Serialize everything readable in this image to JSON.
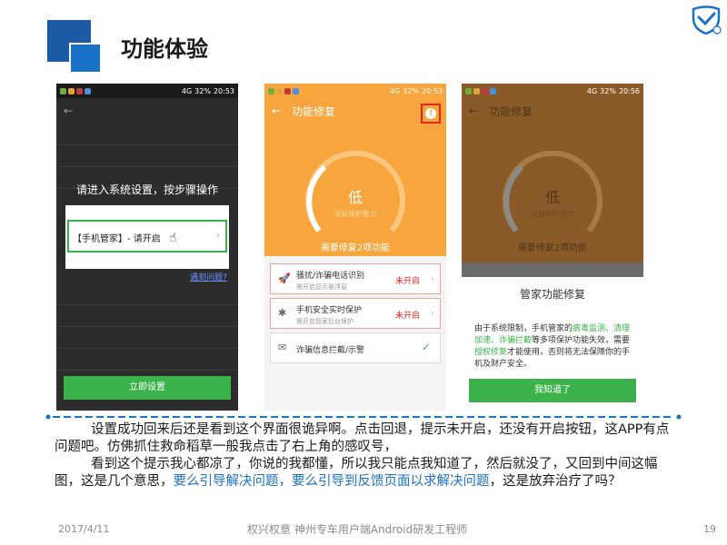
{
  "slide": {
    "title": "功能体验",
    "logo_icon": "shield-check-icon"
  },
  "phone1": {
    "status_time": "20:53",
    "status_battery": "32%",
    "status_signal": "4G",
    "instruction": "请进入系统设置，按步骤操作",
    "item_label": "【手机管家】- 请开启",
    "help_link": "遇到问题?",
    "button_label": "立即设置"
  },
  "phone2": {
    "status_time": "20:53",
    "status_battery": "32%",
    "status_signal": "4G",
    "title": "功能修复",
    "level": "低",
    "level_sub": "当前保护能力",
    "need_fix": "需要修复2项功能",
    "items": [
      {
        "title": "骚扰/诈骗电话识别",
        "sub": "需开启显示悬浮窗",
        "status": "未开启"
      },
      {
        "title": "手机安全实时保护",
        "sub": "需开启管家后台保护",
        "status": "未开启"
      },
      {
        "title": "诈骗信息拦截/示警"
      }
    ],
    "colors": {
      "header": "#f6a63c",
      "alert": "#e8251d"
    }
  },
  "phone3": {
    "status_time": "20:56",
    "status_battery": "32%",
    "status_signal": "4G",
    "title": "功能修复",
    "level": "低",
    "level_sub": "当前保护能力",
    "need_fix": "需要修复2项功能",
    "dialog_title": "管家功能修复",
    "dialog_p1": "由于系统限制，手机管家的",
    "dialog_h1": "病毒监测、清理加速、诈骗拦截",
    "dialog_p2": "等多项保护功能失效，需要",
    "dialog_h2": "授权修复",
    "dialog_p3": "才能使用，否则将无法保障你的手机及财产安全。",
    "button_label": "我知道了"
  },
  "body": {
    "line1": "设置成功回来后还是看到这个界面很诡异啊。点击回退，提示未开启，还没有开启按钮，这APP有点问题吧。仿佛抓住救命稻草一般我点击了右上角的感叹号，",
    "line2_a": "看到这个提示我心都凉了，你说的我都懂，所以我只能点我知道了，然后就没了，又回到中间这幅图，这是几个意思，",
    "line2_hl": "要么引导解决问题，要么引导到反馈页面以求解决问题",
    "line2_b": "，这是放弃治疗了吗？"
  },
  "footer": {
    "date": "2017/4/11",
    "center": "权兴权意 神州专车用户端Android研发工程师",
    "page": "19"
  }
}
